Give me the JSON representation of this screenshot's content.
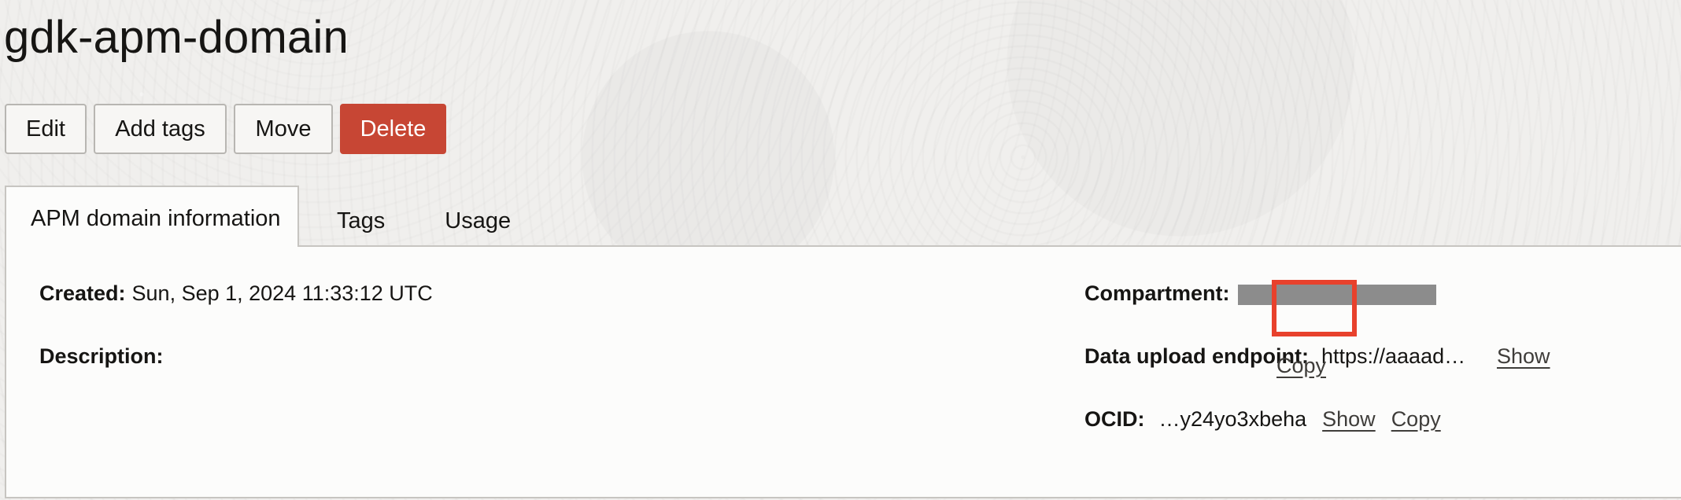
{
  "page": {
    "title": "gdk-apm-domain"
  },
  "actions": {
    "edit": "Edit",
    "add_tags": "Add tags",
    "move": "Move",
    "delete": "Delete"
  },
  "tabs": [
    {
      "label": "APM domain information",
      "active": true
    },
    {
      "label": "Tags",
      "active": false
    },
    {
      "label": "Usage",
      "active": false
    }
  ],
  "info": {
    "created_label": "Created:",
    "created_value": "Sun, Sep 1, 2024 11:33:12 UTC",
    "description_label": "Description:",
    "description_value": "",
    "compartment_label": "Compartment:",
    "endpoint_label": "Data upload endpoint:",
    "endpoint_value": "https://aaaad…",
    "endpoint_show": "Show",
    "endpoint_copy": "Copy",
    "ocid_label": "OCID:",
    "ocid_value": "…y24yo3xbeha",
    "ocid_show": "Show",
    "ocid_copy": "Copy"
  },
  "colors": {
    "delete_button": "#c74634",
    "highlight_box": "#e8412c",
    "redaction": "#8c8c8c"
  }
}
